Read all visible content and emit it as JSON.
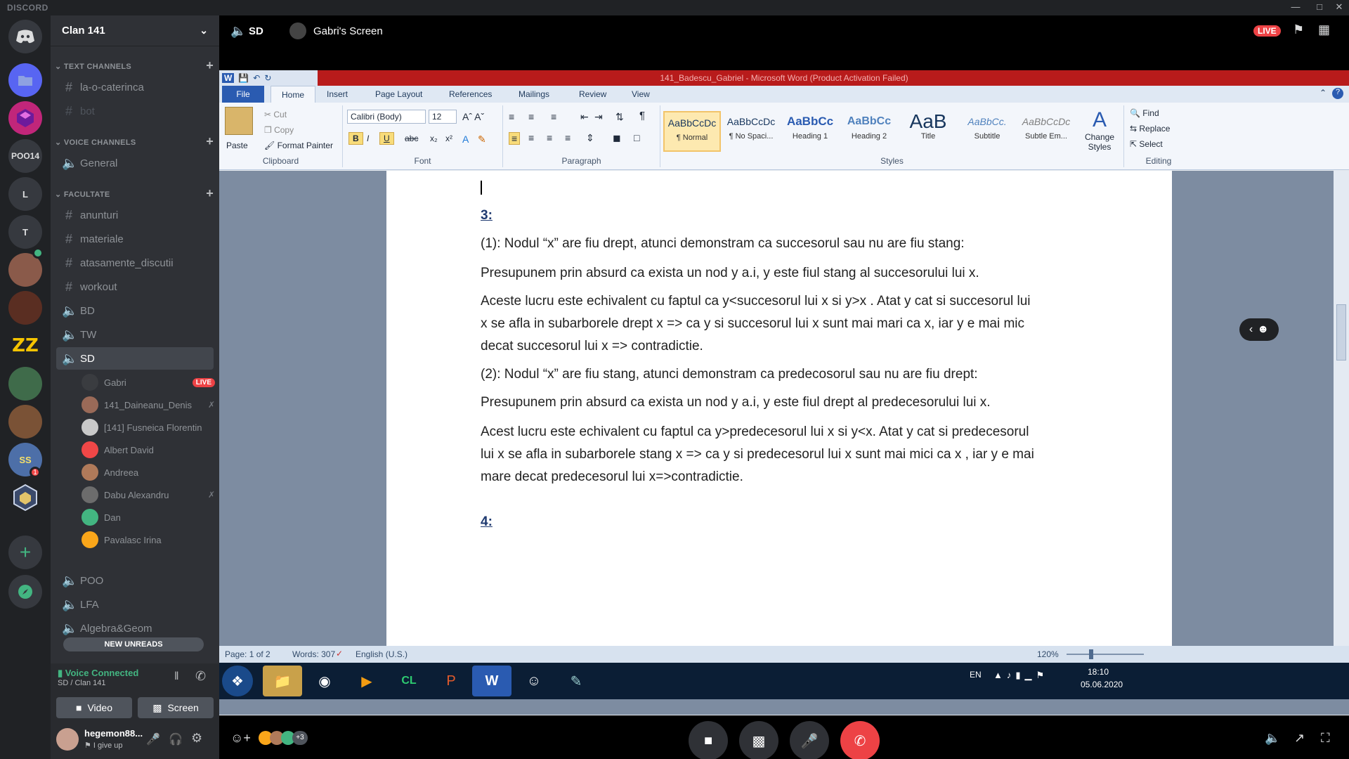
{
  "titlebar": {
    "brand": "DISCORD"
  },
  "servers": [
    {
      "label": "POO14"
    },
    {
      "label": "L"
    },
    {
      "label": "T"
    },
    {
      "label": "ZZ"
    },
    {
      "label": "SS",
      "badge": "1"
    }
  ],
  "guild": {
    "name": "Clan 141"
  },
  "categories": {
    "text": "TEXT CHANNELS",
    "voice": "VOICE CHANNELS",
    "facultate": "FACULTATE"
  },
  "text_channels": [
    {
      "name": "la-o-caterinca"
    },
    {
      "name": "bot"
    }
  ],
  "voice_general": {
    "name": "General"
  },
  "facultate_channels": [
    {
      "name": "anunturi"
    },
    {
      "name": "materiale"
    },
    {
      "name": "atasamente_discutii"
    },
    {
      "name": "workout"
    },
    {
      "name": "BD"
    },
    {
      "name": "TW"
    },
    {
      "name": "SD"
    }
  ],
  "sd_users": [
    {
      "name": "Gabri",
      "live": "LIVE"
    },
    {
      "name": "141_Daineanu_Denis"
    },
    {
      "name": "[141] Fusneica Florentin"
    },
    {
      "name": "Albert David"
    },
    {
      "name": "Andreea"
    },
    {
      "name": "Dabu Alexandru"
    },
    {
      "name": "Dan"
    },
    {
      "name": "Pavalasc Irina"
    }
  ],
  "more_voice": [
    {
      "name": "POO"
    },
    {
      "name": "LFA"
    },
    {
      "name": "Algebra&Geom"
    }
  ],
  "new_unreads": "NEW UNREADS",
  "voice_panel": {
    "status": "Voice Connected",
    "location": "SD / Clan 141",
    "video_label": "Video",
    "screen_label": "Screen"
  },
  "user_panel": {
    "name": "hegemon88...",
    "status": "I give up"
  },
  "stage_header": {
    "channel": "SD",
    "screen": "Gabri's Screen",
    "live": "LIVE"
  },
  "word": {
    "title": "141_Badescu_Gabriel - Microsoft Word (Product Activation Failed)",
    "tabs": [
      "File",
      "Home",
      "Insert",
      "Page Layout",
      "References",
      "Mailings",
      "Review",
      "View"
    ],
    "clipboard": {
      "paste": "Paste",
      "cut": "Cut",
      "copy": "Copy",
      "format_painter": "Format Painter",
      "label": "Clipboard"
    },
    "font": {
      "name": "Calibri (Body)",
      "size": "12",
      "label": "Font"
    },
    "paragraph": {
      "label": "Paragraph"
    },
    "styles": [
      {
        "preview": "AaBbCcDc",
        "name": "¶ Normal"
      },
      {
        "preview": "AaBbCcDc",
        "name": "¶ No Spaci..."
      },
      {
        "preview": "AaBbCc",
        "name": "Heading 1"
      },
      {
        "preview": "AaBbCc",
        "name": "Heading 2"
      },
      {
        "preview": "AaB",
        "name": "Title"
      },
      {
        "preview": "AaBbCc.",
        "name": "Subtitle"
      },
      {
        "preview": "AaBbCcDc",
        "name": "Subtle Em..."
      }
    ],
    "styles_label": "Styles",
    "change_styles": "Change Styles",
    "editing": {
      "find": "Find",
      "replace": "Replace",
      "select": "Select",
      "label": "Editing"
    },
    "doc": {
      "h3": "3:",
      "p1": "(1): Nodul  “x” are fiu drept, atunci demonstram  ca succesorul  sau nu are fiu stang:",
      "p2": "Presupunem prin absurd ca exista  un nod y a.i, y este fiul stang al succesorului  lui x.",
      "p3a": "Aceste  lucru este  echivalent  cu faptul ca y<succesorul lui x si y>x . Atat y cat si succesorul  lui",
      "p3b": "x se afla in subarborele drept x => ca y si succesorul lui x sunt mai mari ca x, iar y e mai mic",
      "p3c": "decat succesorul  lui x => contradictie.",
      "p4": "(2): Nodul “x” are fiu stang,  atunci demonstram  ca predecosorul  sau nu are fiu drept:",
      "p5": "Presupunem prin absurd ca exista  un nod y a.i, y este fiul drept al predecesorului  lui x.",
      "p6a": "Acest lucru este echivalent  cu faptul ca y>predecesorul lui x si y<x. Atat y cat si predecesorul",
      "p6b": "lui x se afla in subarborele stang x => ca y si predecesorul lui x sunt mai mici ca x , iar y e mai",
      "p6c": "mare decat  predecesorul  lui  x=>contradictie.",
      "h4": "4:"
    },
    "status": {
      "page": "Page: 1 of 2",
      "words": "Words: 307",
      "lang": "English (U.S.)",
      "zoom": "120%"
    },
    "tray": {
      "lang": "EN",
      "time": "18:10",
      "date": "05.06.2020"
    }
  },
  "participants_more": "+3"
}
